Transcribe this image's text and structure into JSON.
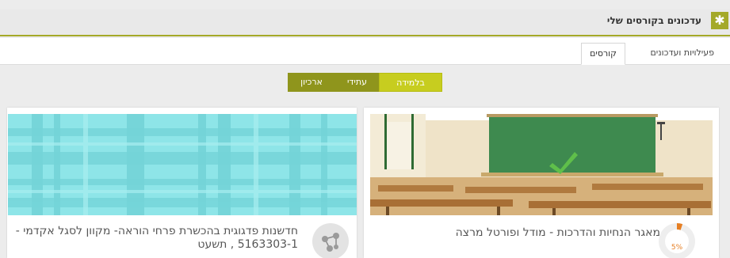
{
  "block": {
    "title": "עדכונים בקורסים שלי",
    "icon": "asterisk-icon"
  },
  "tabs": [
    {
      "label": "פעילויות ועדכונים",
      "active": false
    },
    {
      "label": "קורסים",
      "active": true
    }
  ],
  "filter": {
    "segments": [
      {
        "label": "בלמידה",
        "active": true
      },
      {
        "label": "עתידי",
        "active": false
      },
      {
        "label": "ארכיון",
        "active": false
      }
    ]
  },
  "courses": [
    {
      "title": "מאגר הנחיות והדרכות - מודל ופורטל מרצה",
      "progress": "5%",
      "progress_fraction": 0.05,
      "image": "classroom-image"
    },
    {
      "title": "חדשנות פדגוגית בהכשרת פרחי הוראה- מקוון לסגל אקדמי - 5163303-1 , תשעט",
      "image": "cyan-plaid-pattern",
      "icon": "course-network-icon"
    }
  ],
  "colors": {
    "accent": "#a4a928",
    "segment_active": "#c7cd1f",
    "segment_inactive": "#8f951c",
    "progress": "#e67e22",
    "plaid": "#8ee5e8"
  }
}
